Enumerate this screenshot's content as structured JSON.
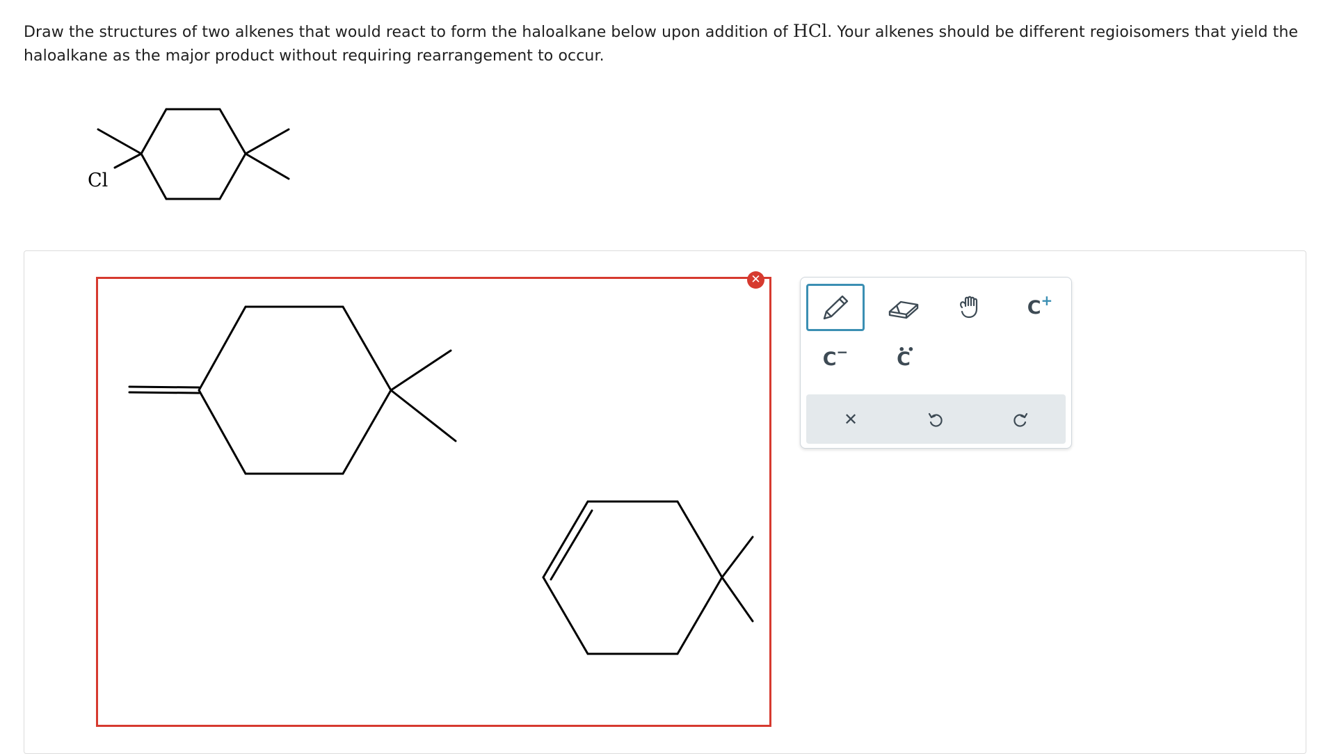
{
  "question": {
    "text_before": "Draw the structures of two alkenes that would react to form the haloalkane below upon addition of ",
    "reagent": "HCl",
    "text_after": ". Your alkenes should be different regioisomers that yield the haloalkane as the major product without requiring rearrangement to occur."
  },
  "given_molecule": {
    "halogen_label": "Cl"
  },
  "canvas": {
    "clear_glyph": "✕"
  },
  "toolbar": {
    "tools": [
      {
        "name": "pencil-tool",
        "icon": "pencil-icon",
        "selected": true
      },
      {
        "name": "eraser-tool",
        "icon": "eraser-icon",
        "selected": false
      },
      {
        "name": "move-tool",
        "icon": "hand-icon",
        "selected": false
      },
      {
        "name": "carbocation-tool",
        "icon": "carbocation-icon",
        "label": "C",
        "charge": "+"
      },
      {
        "name": "carbanion-tool",
        "icon": "carbanion-icon",
        "label": "C",
        "charge": "−"
      },
      {
        "name": "lone-pair-tool",
        "icon": "lone-pair-icon",
        "label": "C"
      }
    ],
    "actions": [
      {
        "name": "clear-button",
        "icon": "close-icon",
        "glyph": "✕"
      },
      {
        "name": "undo-button",
        "icon": "undo-icon"
      },
      {
        "name": "redo-button",
        "icon": "redo-icon"
      }
    ],
    "accent_color": "#3b8fb3",
    "icon_color": "#3d4a54"
  },
  "colors": {
    "canvas_border": "#d63a2f",
    "action_bar": "#e4e9ec"
  }
}
